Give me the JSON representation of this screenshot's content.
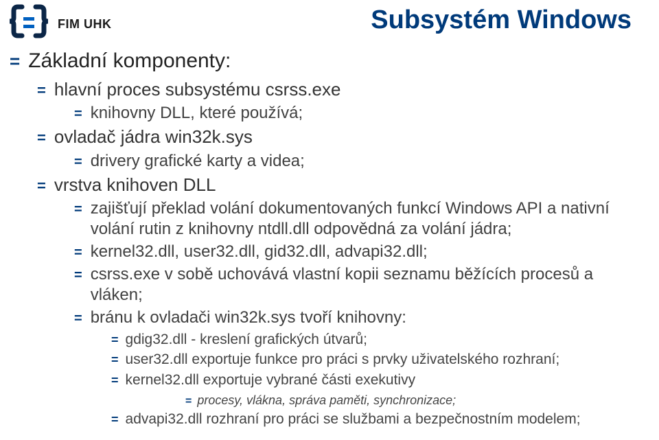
{
  "logo_label": "FIM UHK",
  "title": "Subsystém Windows",
  "items": {
    "l0_1": "Základní komponenty:",
    "l1_1": "hlavní proces subsystému csrss.exe",
    "l2_1": "knihovny DLL, které používá;",
    "l1_2": "ovladač jádra win32k.sys",
    "l2_2": "drivery grafické karty a videa;",
    "l1_3": "vrstva knihoven DLL",
    "l2_3": "zajišťují překlad volání dokumentovaných funkcí Windows API a nativní volání rutin z knihovny ntdll.dll odpovědná za volání jádra;",
    "l2_4": "kernel32.dll, user32.dll, gid32.dll, advapi32.dll;",
    "l2_5": "csrss.exe v sobě uchovává vlastní kopii seznamu běžících procesů a vláken;",
    "l2_6": "bránu k ovladači win32k.sys tvoří knihovny:",
    "l3_1": "gdig32.dll - kreslení grafických útvarů;",
    "l3_2": "user32.dll exportuje funkce pro práci s prvky uživatelského rozhraní;",
    "l3_3": "kernel32.dll exportuje vybrané části exekutivy",
    "l4_1": "procesy, vlákna, správa paměti, synchronizace;",
    "l3_4": "advapi32.dll rozhraní pro práci se službami a bezpečnostním modelem;"
  }
}
